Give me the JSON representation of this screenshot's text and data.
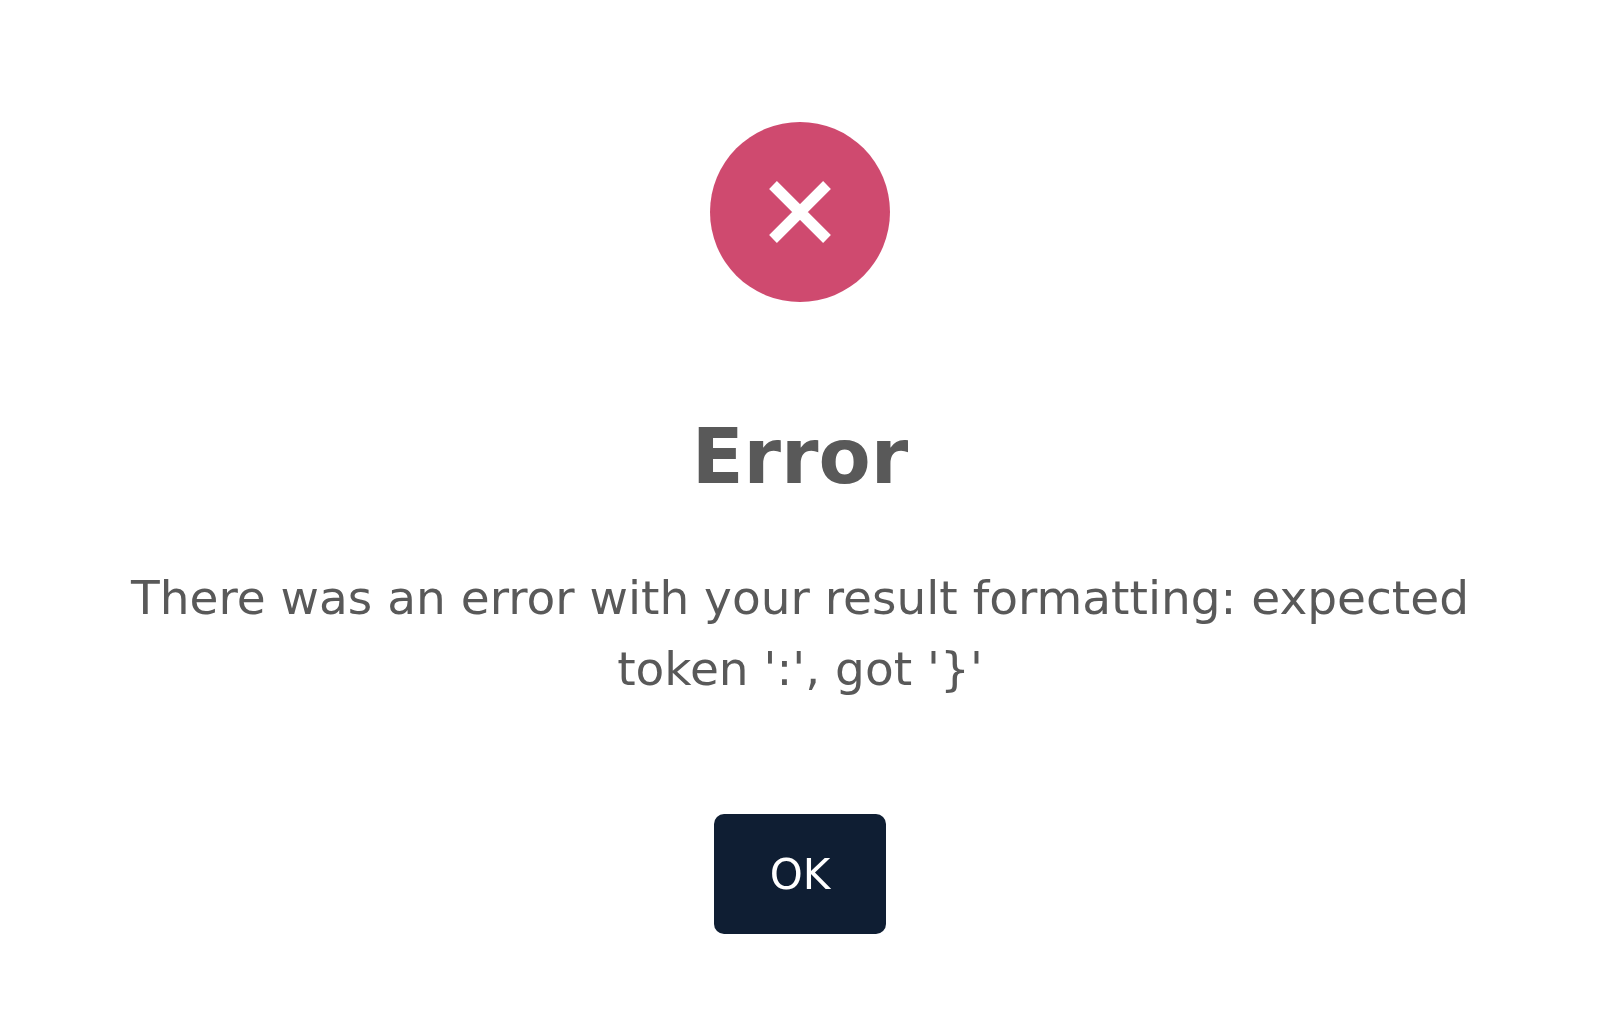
{
  "dialog": {
    "kind": "error",
    "title": "Error",
    "message": "There was an error with your result formatting: expected token ':', got '}'",
    "button": "OK"
  }
}
